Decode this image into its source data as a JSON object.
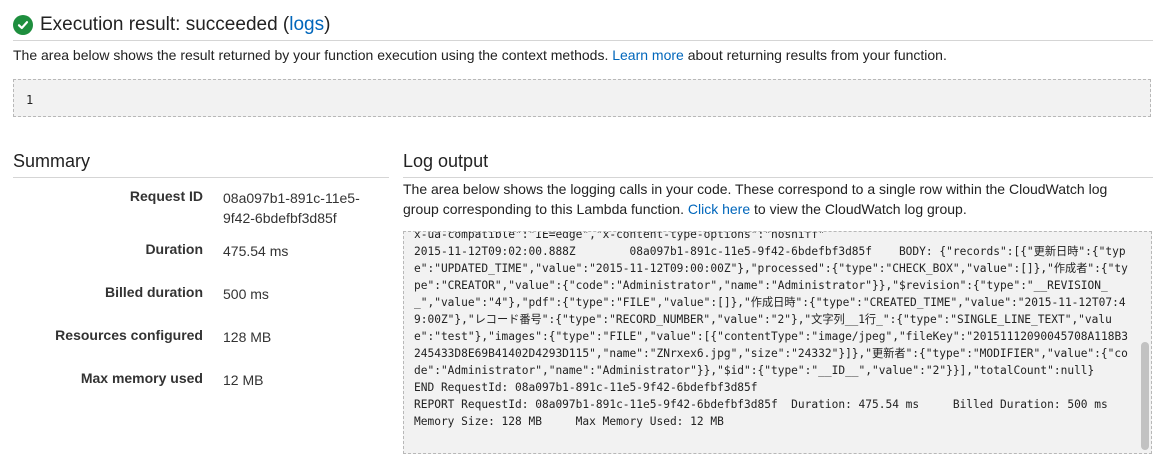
{
  "header": {
    "title_prefix": "Execution result: succeeded (",
    "logs_link": "logs",
    "title_suffix": ")"
  },
  "result": {
    "description_prefix": "The area below shows the result returned by your function execution using the context methods. ",
    "learn_more_link": "Learn more",
    "description_suffix": " about returning results from your function.",
    "value": "1"
  },
  "summary": {
    "title": "Summary",
    "rows": [
      {
        "label": "Request ID",
        "value": "08a097b1-891c-11e5-9f42-6bdefbf3d85f"
      },
      {
        "label": "Duration",
        "value": "475.54 ms"
      },
      {
        "label": "Billed duration",
        "value": "500 ms"
      },
      {
        "label": "Resources configured",
        "value": "128 MB"
      },
      {
        "label": "Max memory used",
        "value": "12 MB"
      }
    ]
  },
  "log": {
    "title": "Log output",
    "description_prefix": "The area below shows the logging calls in your code. These correspond to a single row within the CloudWatch log group corresponding to this Lambda function. ",
    "click_here_link": "Click here",
    "description_suffix": " to view the CloudWatch log group.",
    "content": "x-ua-compatible\":\"IE=edge\",\"x-content-type-options\":\"nosniff\"\n2015-11-12T09:02:00.888Z        08a097b1-891c-11e5-9f42-6bdefbf3d85f    BODY: {\"records\":[{\"更新日時\":{\"type\":\"UPDATED_TIME\",\"value\":\"2015-11-12T09:00:00Z\"},\"processed\":{\"type\":\"CHECK_BOX\",\"value\":[]},\"作成者\":{\"type\":\"CREATOR\",\"value\":{\"code\":\"Administrator\",\"name\":\"Administrator\"}},\"$revision\":{\"type\":\"__REVISION__\",\"value\":\"4\"},\"pdf\":{\"type\":\"FILE\",\"value\":[]},\"作成日時\":{\"type\":\"CREATED_TIME\",\"value\":\"2015-11-12T07:49:00Z\"},\"レコード番号\":{\"type\":\"RECORD_NUMBER\",\"value\":\"2\"},\"文字列__1行_\":{\"type\":\"SINGLE_LINE_TEXT\",\"value\":\"test\"},\"images\":{\"type\":\"FILE\",\"value\":[{\"contentType\":\"image/jpeg\",\"fileKey\":\"20151112090045708A118B3245433D8E69B41402D4293D115\",\"name\":\"ZNrxex6.jpg\",\"size\":\"24332\"}]},\"更新者\":{\"type\":\"MODIFIER\",\"value\":{\"code\":\"Administrator\",\"name\":\"Administrator\"}},\"$id\":{\"type\":\"__ID__\",\"value\":\"2\"}}],\"totalCount\":null}\nEND RequestId: 08a097b1-891c-11e5-9f42-6bdefbf3d85f\nREPORT RequestId: 08a097b1-891c-11e5-9f42-6bdefbf3d85f  Duration: 475.54 ms     Billed Duration: 500 ms   Memory Size: 128 MB     Max Memory Used: 12 MB"
  },
  "colors": {
    "success": "#1e8e3e",
    "link": "#0066bb",
    "box_bg": "#f2f2f2"
  },
  "icons": {
    "status": "check-circle-icon"
  }
}
